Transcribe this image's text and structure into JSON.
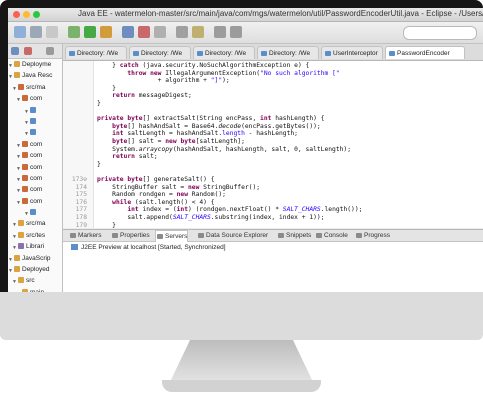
{
  "window": {
    "title": "Java EE - watermelon-master/src/main/java/com/mgs/watermelon/util/PasswordEncoderUtil.java - Eclipse - /Users/dudusmida/practi"
  },
  "explorer": {
    "rows": [
      {
        "label": "Deployme",
        "icon": "folder-icon"
      },
      {
        "label": "Java Resc",
        "icon": "folder-icon"
      },
      {
        "label": "src/ma",
        "icon": "package-icon"
      },
      {
        "label": "com",
        "icon": "package-icon"
      },
      {
        "label": "",
        "icon": "java-file-icon"
      },
      {
        "label": "",
        "icon": "java-file-icon"
      },
      {
        "label": "",
        "icon": "java-file-icon"
      },
      {
        "label": "com",
        "icon": "package-icon"
      },
      {
        "label": "com",
        "icon": "package-icon"
      },
      {
        "label": "com",
        "icon": "package-icon"
      },
      {
        "label": "com",
        "icon": "package-icon"
      },
      {
        "label": "com",
        "icon": "package-icon"
      },
      {
        "label": "com",
        "icon": "package-icon"
      },
      {
        "label": "",
        "icon": "java-file-icon"
      },
      {
        "label": "src/ma",
        "icon": "folder-icon"
      },
      {
        "label": "src/tes",
        "icon": "folder-icon"
      },
      {
        "label": "Librari",
        "icon": "library-icon"
      },
      {
        "label": "JavaScrip",
        "icon": "folder-icon"
      },
      {
        "label": "Deployed",
        "icon": "folder-icon"
      },
      {
        "label": "src",
        "icon": "folder-icon"
      },
      {
        "label": "main",
        "icon": "folder-icon"
      }
    ]
  },
  "editor_tabs": [
    {
      "label": "Directory: /We"
    },
    {
      "label": "Directory: /We"
    },
    {
      "label": "Directory: /We"
    },
    {
      "label": "Directory: /We"
    },
    {
      "label": "UserInterceptor"
    },
    {
      "label": "PasswordEncoder",
      "active": true
    }
  ],
  "code_lines": [
    {
      "ln": "",
      "html": "    } <span class=\"kw\">catch</span> (java.security.NoSuchAlgorithmException e) {"
    },
    {
      "ln": "",
      "html": "        <span class=\"kw\">throw new</span> IllegalArgumentException(<span class=\"str\">\"No such algorithm [\"</span>"
    },
    {
      "ln": "",
      "html": "                + algorithm + <span class=\"str\">\"]\"</span>);"
    },
    {
      "ln": "",
      "html": "    }"
    },
    {
      "ln": "",
      "html": "    <span class=\"kw\">return</span> messageDigest;"
    },
    {
      "ln": "",
      "html": "}"
    },
    {
      "ln": "",
      "html": ""
    },
    {
      "ln": "",
      "html": "<span class=\"kw\">private</span> <span class=\"kw\">byte</span>[] extractSalt(String encPass, <span class=\"kw\">int</span> hashLength) {"
    },
    {
      "ln": "",
      "html": "    <span class=\"kw\">byte</span>[] hashAndSalt = Base64.<span class=\"ital\">decode</span>(encPass.getBytes());"
    },
    {
      "ln": "",
      "html": "    <span class=\"kw\">int</span> saltLength = hashAndSalt.<span class=\"str\">length</span> - hashLength;"
    },
    {
      "ln": "",
      "html": "    <span class=\"kw\">byte</span>[] salt = <span class=\"kw\">new</span> <span class=\"kw\">byte</span>[saltLength];"
    },
    {
      "ln": "",
      "html": "    System.<span class=\"ital\">arraycopy</span>(hashAndSalt, hashLength, salt, 0, saltLength);"
    },
    {
      "ln": "",
      "html": "    <span class=\"kw\">return</span> salt;"
    },
    {
      "ln": "",
      "html": "}"
    },
    {
      "ln": "",
      "html": ""
    },
    {
      "ln": "173⊖",
      "html": "<span class=\"kw\">private</span> <span class=\"kw\">byte</span>[] generateSalt() {"
    },
    {
      "ln": "174",
      "html": "    StringBuffer salt = <span class=\"kw\">new</span> StringBuffer();"
    },
    {
      "ln": "175",
      "html": "    Random rondgen = <span class=\"kw\">new</span> Random();"
    },
    {
      "ln": "176",
      "html": "    <span class=\"kw\">while</span> (salt.length() &lt; 4) {"
    },
    {
      "ln": "177",
      "html": "        <span class=\"kw\">int</span> index = (<span class=\"kw\">int</span>) (rondgen.nextFloat() * <span class=\"str ital\">SALT_CHARS</span>.length());"
    },
    {
      "ln": "178",
      "html": "        salt.append(<span class=\"str ital\">SALT_CHARS</span>.substring(index, index + 1));"
    },
    {
      "ln": "179",
      "html": "    }"
    }
  ],
  "bottom_tabs": [
    {
      "label": "Markers"
    },
    {
      "label": "Properties"
    },
    {
      "label": "Servers",
      "active": true
    },
    {
      "label": "Data Source Explorer"
    },
    {
      "label": "Snippets"
    },
    {
      "label": "Console"
    },
    {
      "label": "Progress"
    }
  ],
  "servers": {
    "row": "J2EE Preview at localhost  [Started, Synchronized]"
  },
  "colors": {
    "keyword": "#7f0055",
    "string": "#2a00ff",
    "bezel": "#161616",
    "frame": "#d7d7d7"
  }
}
